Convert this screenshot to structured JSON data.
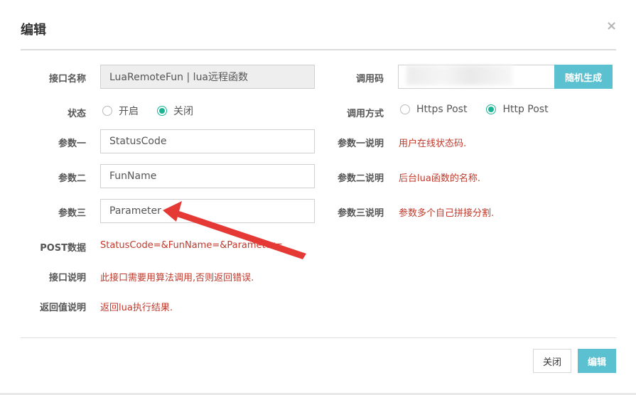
{
  "modal": {
    "title": "编辑",
    "close_icon": "×"
  },
  "left": {
    "interface_name": {
      "label": "接口名称",
      "value": "LuaRemoteFun | lua远程函数"
    },
    "status": {
      "label": "状态",
      "options": [
        "开启",
        "关闭"
      ],
      "selected": "关闭"
    },
    "param1": {
      "label": "参数一",
      "value": "StatusCode"
    },
    "param2": {
      "label": "参数二",
      "value": "FunName"
    },
    "param3": {
      "label": "参数三",
      "value": "Parameter"
    },
    "post_data": {
      "label": "POST数据",
      "value": "StatusCode=&FunName=&Parameter="
    },
    "interface_desc": {
      "label": "接口说明",
      "value": "此接口需要用算法调用,否则返回错误."
    },
    "return_desc": {
      "label": "返回值说明",
      "value": "返回lua执行结果."
    }
  },
  "right": {
    "call_code": {
      "label": "调用码",
      "button": "随机生成"
    },
    "call_method": {
      "label": "调用方式",
      "options": [
        "Https Post",
        "Http Post"
      ],
      "selected": "Http Post"
    },
    "param1_desc": {
      "label": "参数一说明",
      "value": "用户在线状态码."
    },
    "param2_desc": {
      "label": "参数二说明",
      "value": "后台lua函数的名称."
    },
    "param3_desc": {
      "label": "参数三说明",
      "value": "参数多个自己拼接分割."
    }
  },
  "footer": {
    "close_label": "关闭",
    "edit_label": "编辑"
  },
  "colors": {
    "accent": "#5bc0cf",
    "radio": "#1ab394",
    "desc_text": "#c0392b",
    "arrow": "#e53935"
  }
}
